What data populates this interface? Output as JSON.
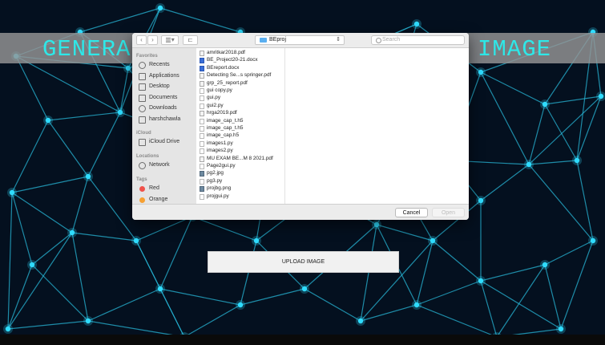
{
  "page": {
    "title_left": "GENERA",
    "title_right": "IMAGE",
    "upload_button": "UPLOAD IMAGE"
  },
  "colors": {
    "title_text": "#2ee8e8",
    "network_line": "#27b6d6",
    "network_node": "#2fdcff",
    "background": "#04101f"
  },
  "dialog": {
    "toolbar": {
      "back_icon": "chevron-left-icon",
      "forward_icon": "chevron-right-icon",
      "view_icon": "columns-view-icon",
      "new_folder_icon": "new-folder-icon",
      "current_folder": "BEproj",
      "search_placeholder": "Search"
    },
    "sidebar": {
      "sections": [
        {
          "header": "Favorites",
          "items": [
            {
              "label": "Recents",
              "icon": "clock-icon"
            },
            {
              "label": "Applications",
              "icon": "applications-icon"
            },
            {
              "label": "Desktop",
              "icon": "desktop-icon"
            },
            {
              "label": "Documents",
              "icon": "documents-icon"
            },
            {
              "label": "Downloads",
              "icon": "downloads-icon"
            },
            {
              "label": "harshchawla",
              "icon": "home-icon"
            }
          ]
        },
        {
          "header": "iCloud",
          "items": [
            {
              "label": "iCloud Drive",
              "icon": "cloud-icon"
            }
          ]
        },
        {
          "header": "Locations",
          "items": [
            {
              "label": "Network",
              "icon": "globe-icon"
            }
          ]
        },
        {
          "header": "Tags",
          "items": [
            {
              "label": "Red",
              "icon": "red-tag-icon"
            },
            {
              "label": "Orange",
              "icon": "orange-tag-icon"
            }
          ]
        }
      ]
    },
    "files": [
      {
        "name": "amritkar2018.pdf",
        "type": "pdf"
      },
      {
        "name": "BE_Project20-21.docx",
        "type": "docx"
      },
      {
        "name": "BEreport.docx",
        "type": "docx"
      },
      {
        "name": "Detecting Se...s springer.pdf",
        "type": "pdf"
      },
      {
        "name": "grp_25_report.pdf",
        "type": "pdf"
      },
      {
        "name": "gui copy.py",
        "type": "py"
      },
      {
        "name": "gui.py",
        "type": "py"
      },
      {
        "name": "gui2.py",
        "type": "py"
      },
      {
        "name": "hrga2019.pdf",
        "type": "pdf"
      },
      {
        "name": "image_cap_t.h5",
        "type": "h5"
      },
      {
        "name": "image_cap_t.h5",
        "type": "h5"
      },
      {
        "name": "image_cap.h5",
        "type": "h5"
      },
      {
        "name": "images1.py",
        "type": "py"
      },
      {
        "name": "images2.py",
        "type": "py"
      },
      {
        "name": "MU EXAM BE...M 8 2021.pdf",
        "type": "pdf"
      },
      {
        "name": "Page2gui.py",
        "type": "py"
      },
      {
        "name": "pg2.jpg",
        "type": "img"
      },
      {
        "name": "pg3.py",
        "type": "py"
      },
      {
        "name": "projbg.png",
        "type": "img"
      },
      {
        "name": "projgui.py",
        "type": "py"
      }
    ],
    "footer": {
      "cancel": "Cancel",
      "open": "Open"
    }
  }
}
